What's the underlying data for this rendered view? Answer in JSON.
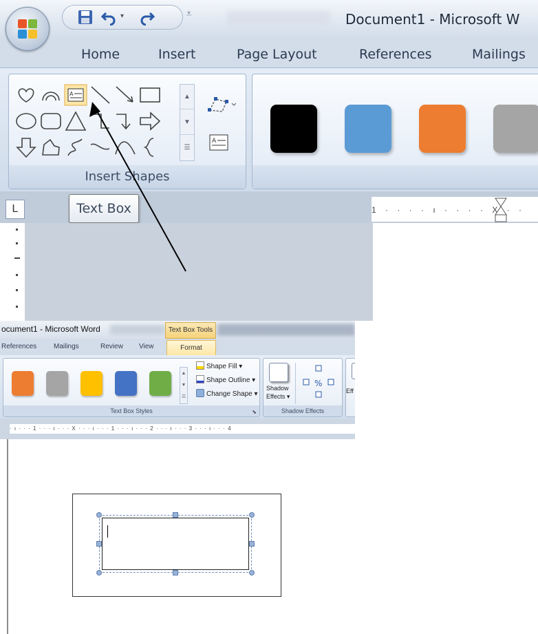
{
  "top": {
    "window_title": "Document1 - Microsoft W",
    "tabs": [
      "Home",
      "Insert",
      "Page Layout",
      "References",
      "Mailings"
    ],
    "group_insert_shapes": "Insert Shapes",
    "tooltip": "Text Box",
    "swatch_colors": [
      "#000000",
      "#5b9bd5",
      "#ed7d31",
      "#a5a5a5"
    ],
    "ruler_marks": "1 · · · · ı · · · · X · ·",
    "tab_stop_symbol": "L"
  },
  "bottom": {
    "window_title": "ocument1 - Microsoft Word",
    "contextual_tab": "Text Box Tools",
    "tabs": [
      "References",
      "Mailings",
      "Review",
      "View"
    ],
    "active_tab": "Format",
    "swatch_colors": [
      "#ed7d31",
      "#a5a5a5",
      "#ffc000",
      "#4472c4",
      "#70ad47"
    ],
    "commands": {
      "shape_fill": "Shape Fill ▾",
      "shape_outline": "Shape Outline ▾",
      "change_shape": "Change Shape ▾"
    },
    "shadow_effects_button_line1": "Shadow",
    "shadow_effects_button_line2": "Effects ▾",
    "effects_partial": "Eff",
    "group_text_box_styles": "Text Box Styles",
    "group_shadow_effects": "Shadow Effects",
    "ruler_marks": "· ı · · · 1 · · · ı · · · X · · · ı · · · 1 · · · ı · · · 2 · · · ı · · · 3 · · · ı · · · 4"
  }
}
